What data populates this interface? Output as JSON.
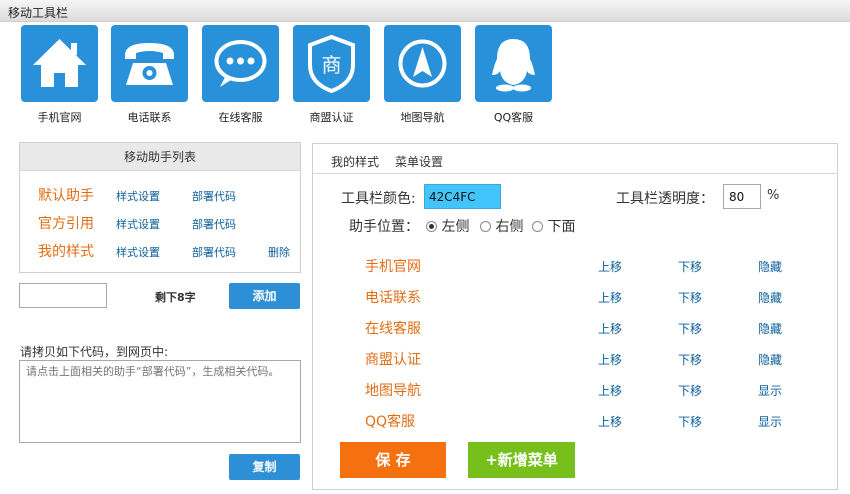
{
  "window": {
    "title": "移动工具栏"
  },
  "tiles": [
    {
      "label": "手机官网",
      "icon": "home-icon"
    },
    {
      "label": "电话联系",
      "icon": "telephone-icon"
    },
    {
      "label": "在线客服",
      "icon": "chat-bubble-icon"
    },
    {
      "label": "商盟认证",
      "icon": "shield-badge-icon",
      "glyph": "商"
    },
    {
      "label": "地图导航",
      "icon": "compass-arrow-icon"
    },
    {
      "label": "QQ客服",
      "icon": "qq-penguin-icon"
    }
  ],
  "assistant_list": {
    "title": "移动助手列表",
    "items": [
      {
        "name": "默认助手",
        "style_link": "样式设置",
        "deploy_link": "部署代码",
        "delete_link": ""
      },
      {
        "name": "官方引用",
        "style_link": "样式设置",
        "deploy_link": "部署代码",
        "delete_link": ""
      },
      {
        "name": "我的样式",
        "style_link": "样式设置",
        "deploy_link": "部署代码",
        "delete_link": "删除"
      }
    ]
  },
  "add_form": {
    "input_value": "",
    "remaining": "剩下8字",
    "add_button": "添加"
  },
  "code_section": {
    "label": "请拷贝如下代码，到网页中:",
    "placeholder": "请点击上面相关的助手“部署代码”，生成相关代码。",
    "copy_button": "复制"
  },
  "settings": {
    "tabs": [
      "我的样式",
      "菜单设置"
    ],
    "toolbar_color_label": "工具栏颜色:",
    "toolbar_color_value": "42C4FC",
    "opacity_label": "工具栏透明度：",
    "opacity_value": "80",
    "opacity_unit": "%",
    "position_label": "助手位置：",
    "position_options": [
      "左侧",
      "右侧",
      "下面"
    ],
    "position_selected": "左侧",
    "menu_items": [
      {
        "name": "手机官网",
        "up": "上移",
        "down": "下移",
        "toggle": "隐藏"
      },
      {
        "name": "电话联系",
        "up": "上移",
        "down": "下移",
        "toggle": "隐藏"
      },
      {
        "name": "在线客服",
        "up": "上移",
        "down": "下移",
        "toggle": "隐藏"
      },
      {
        "name": "商盟认证",
        "up": "上移",
        "down": "下移",
        "toggle": "隐藏"
      },
      {
        "name": "地图导航",
        "up": "上移",
        "down": "下移",
        "toggle": "显示"
      },
      {
        "name": "QQ客服",
        "up": "上移",
        "down": "下移",
        "toggle": "显示"
      }
    ],
    "save_button": "保 存",
    "add_menu_button": "+新增菜单"
  },
  "colors": {
    "tile_blue": "#2991d9",
    "orange_text": "#e26d15",
    "link_blue": "#0b5f9c",
    "save_orange": "#f5700f",
    "add_green": "#77c01c",
    "color_field": "#42c4fc"
  }
}
